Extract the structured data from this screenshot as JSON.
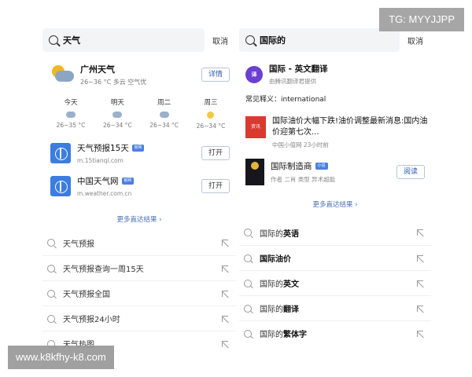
{
  "watermark_top": "TG: MYYJJPP",
  "watermark_bottom": "www.k8kfhy-k8.com",
  "left": {
    "query": "天气",
    "cancel": "取消",
    "weather": {
      "title": "广州天气",
      "summary": "26~36 °C  多云  空气优",
      "detail_btn": "详情",
      "forecast": [
        {
          "day": "今天",
          "range": "26~35 °C",
          "icon": "cloud-icon"
        },
        {
          "day": "明天",
          "range": "26~34 °C",
          "icon": "cloud-icon"
        },
        {
          "day": "周二",
          "range": "26~34 °C",
          "icon": "cloud-icon"
        },
        {
          "day": "周三",
          "range": "26~34 °C",
          "icon": "sun-icon"
        }
      ]
    },
    "sites": [
      {
        "name": "天气预报15天",
        "tag": "官网",
        "url": "m.15tianqi.com",
        "button": "打开"
      },
      {
        "name": "中国天气网",
        "tag": "官网",
        "url": "m.weather.com.cn",
        "button": "打开"
      }
    ],
    "more": "更多直达结果 ›",
    "suggestions": [
      "天气预报",
      "天气预报查询一周15天",
      "天气预报全国",
      "天气预报24小时",
      "天气热图"
    ]
  },
  "right": {
    "query": "国际的",
    "cancel": "取消",
    "translate": {
      "logo": "译",
      "title": "国际 - 英文翻译",
      "sub": "由腾讯翻译君提供"
    },
    "common_def": "常见释义：international",
    "news": {
      "thumb": "资讯",
      "title": "国际油价大幅下跌!油价调整最新消息:国内油价迎第七次...",
      "sub": "中国小值网  23小时前"
    },
    "book": {
      "title": "国际制造商",
      "tag": "小说",
      "meta": "作者  二肖  类型  异术超能",
      "button": "阅读"
    },
    "more": "更多直达结果 ›",
    "suggestions": [
      {
        "prefix": "国际的",
        "bold": "英语"
      },
      {
        "prefix": "",
        "bold": "国际油价"
      },
      {
        "prefix": "国际的",
        "bold": "英文"
      },
      {
        "prefix": "国际的",
        "bold": "翻译"
      },
      {
        "prefix": "国际的",
        "bold": "繁体字"
      }
    ]
  }
}
